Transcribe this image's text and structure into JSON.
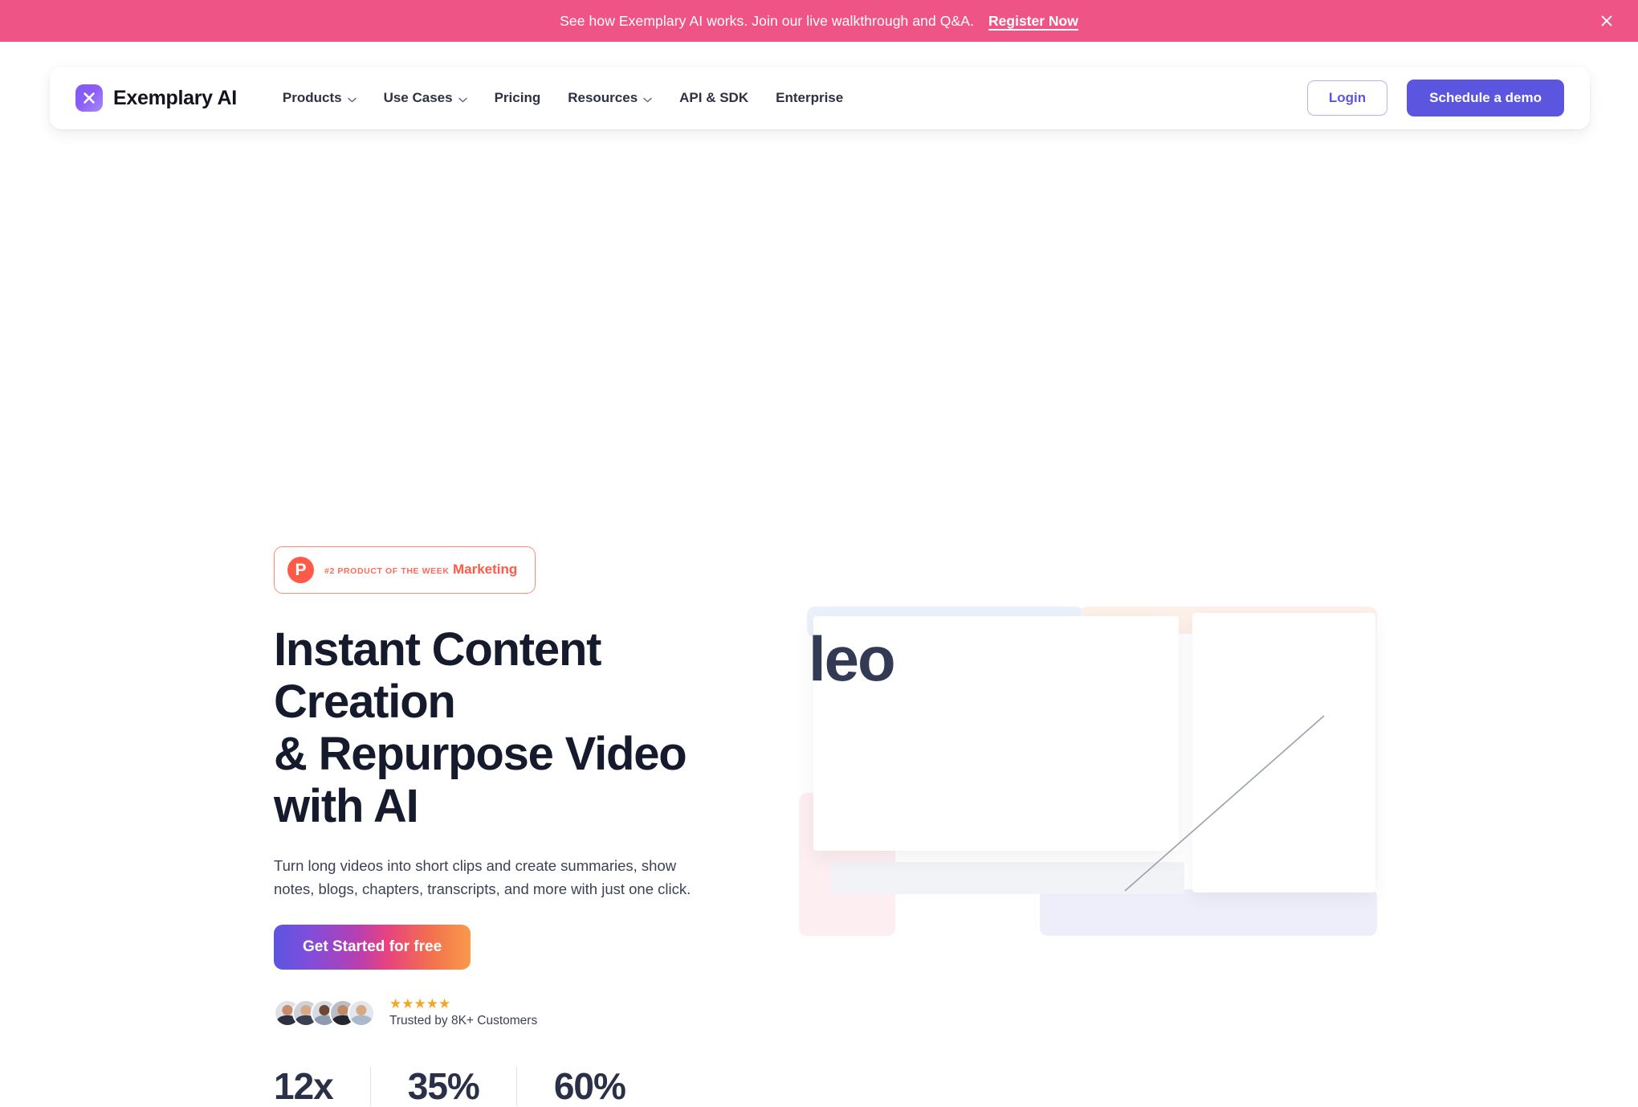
{
  "announcement": {
    "message": "See how Exemplary AI works. Join our live walkthrough and Q&A.",
    "cta_label": "Register Now",
    "close_icon": "close-icon",
    "background_color": "#ee5586"
  },
  "header": {
    "brand": {
      "name": "Exemplary AI",
      "mark_glyph": "X",
      "mark_color": "#7c5cf0"
    },
    "nav": [
      {
        "label": "Products",
        "has_dropdown": true
      },
      {
        "label": "Use Cases",
        "has_dropdown": true
      },
      {
        "label": "Pricing",
        "has_dropdown": false
      },
      {
        "label": "Resources",
        "has_dropdown": true
      },
      {
        "label": "API & SDK",
        "has_dropdown": false
      },
      {
        "label": "Enterprise",
        "has_dropdown": false
      }
    ],
    "login_label": "Login",
    "demo_label": "Schedule a demo",
    "accent_color": "#5b55e0"
  },
  "hero": {
    "badge": {
      "mark_glyph": "P",
      "kicker": "#2 PRODUCT OF THE WEEK",
      "title": "Marketing",
      "accent_color": "#ff5a47"
    },
    "title_lines": [
      "Instant Content Creation",
      "& Repurpose Video",
      "with AI"
    ],
    "title": "Instant Content Creation & Repurpose Video with AI",
    "subtitle": "Turn long videos into short clips and create summaries, show notes, blogs, chapters, transcripts, and more with just one click.",
    "cta_label": "Get Started for free",
    "social_proof": {
      "avatar_count": 5,
      "stars": "★★★★★",
      "star_count": 5,
      "star_color": "#f5a623",
      "trust_text": "Trusted by 8K+ Customers"
    },
    "stats": [
      {
        "value": "12x"
      },
      {
        "value": "35%"
      },
      {
        "value": "60%"
      }
    ],
    "visual": {
      "fragment_text": "leo"
    }
  }
}
